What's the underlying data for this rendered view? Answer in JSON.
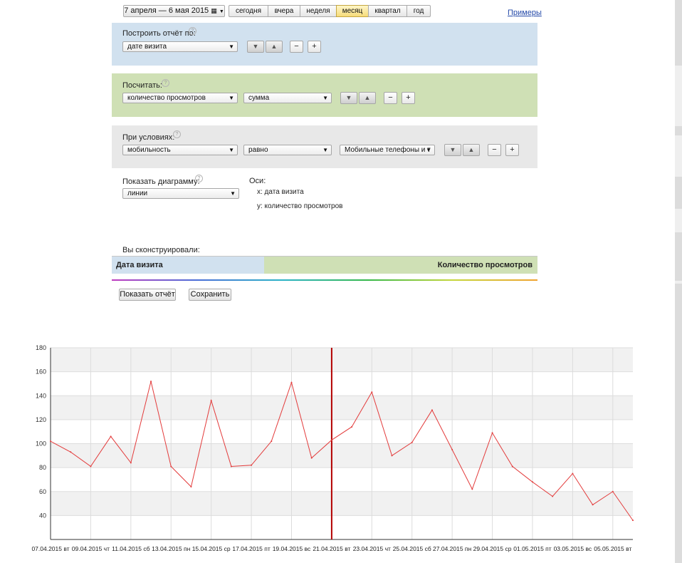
{
  "date_range": {
    "label": "7 апреля — 6 мая 2015"
  },
  "periods": [
    "сегодня",
    "вчера",
    "неделя",
    "месяц",
    "квартал",
    "год"
  ],
  "active_period": "месяц",
  "examples_link": "Примеры",
  "build": {
    "label": "Построить отчёт по:",
    "select": "дате визита",
    "help": "?",
    "minus": "−",
    "plus": "+"
  },
  "count": {
    "label": "Посчитать:",
    "select1": "количество просмотров",
    "select2": "сумма",
    "help": "?",
    "minus": "−",
    "plus": "+"
  },
  "conditions": {
    "label": "При условиях:",
    "select1": "мобильность",
    "select2": "равно",
    "select3": "Мобильные телефоны и т",
    "help": "?",
    "minus": "−",
    "plus": "+"
  },
  "diagram": {
    "label": "Показать диаграмму:",
    "select": "линии",
    "help": "?"
  },
  "axes": {
    "label": "Оси:",
    "x": "x:  дата визита",
    "y": "y:  количество просмотров"
  },
  "constructed": {
    "label": "Вы сконструировали:",
    "left": "Дата визита",
    "right": "Количество просмотров"
  },
  "actions": {
    "show": "Показать отчёт",
    "save": "Сохранить"
  },
  "colors": {
    "build_panel": "#d1e1ef",
    "count_panel": "#cfe0b5",
    "cond_panel": "#e8e8e8",
    "line": "#e33b3b",
    "marker": "#b30000",
    "active_period": "#f6dc7a"
  },
  "icons": {
    "calendar": "calendar-icon",
    "dropdown": "chevron-down-icon",
    "move_down": "arrow-down-icon",
    "move_up": "arrow-up-icon",
    "help": "help-icon"
  },
  "chart_data": {
    "type": "line",
    "title": "",
    "xlabel": "",
    "ylabel": "",
    "ylim": [
      20,
      180
    ],
    "yticks": [
      40,
      60,
      80,
      100,
      120,
      140,
      160,
      180
    ],
    "grid": true,
    "marker_index": 14,
    "x": [
      "07.04.2015 вт",
      "08.04.2015 ср",
      "09.04.2015 чт",
      "10.04.2015 пт",
      "11.04.2015 сб",
      "12.04.2015 вс",
      "13.04.2015 пн",
      "14.04.2015 вт",
      "15.04.2015 ср",
      "16.04.2015 чт",
      "17.04.2015 пт",
      "18.04.2015 сб",
      "19.04.2015 вс",
      "20.04.2015 пн",
      "21.04.2015 вт",
      "22.04.2015 ср",
      "23.04.2015 чт",
      "24.04.2015 пт",
      "25.04.2015 сб",
      "26.04.2015 вс",
      "27.04.2015 пн",
      "28.04.2015 вт",
      "29.04.2015 ср",
      "30.04.2015 чт",
      "01.05.2015 пт",
      "02.05.2015 сб",
      "03.05.2015 вс",
      "04.05.2015 пн",
      "05.05.2015 вт",
      "06.05.2015 ср"
    ],
    "tick_labels": [
      "07.04.2015 вт",
      "09.04.2015 чт",
      "11.04.2015 сб",
      "13.04.2015 пн",
      "15.04.2015 ср",
      "17.04.2015 пт",
      "19.04.2015 вс",
      "21.04.2015 вт",
      "23.04.2015 чт",
      "25.04.2015 сб",
      "27.04.2015 пн",
      "29.04.2015 ср",
      "01.05.2015 пт",
      "03.05.2015 вс",
      "05.05.2015 вт"
    ],
    "series": [
      {
        "values": [
          102,
          93,
          81,
          106,
          84,
          152,
          81,
          64,
          136,
          81,
          82,
          102,
          151,
          88,
          103,
          114,
          143,
          90,
          101,
          128,
          95,
          62,
          109,
          81,
          68,
          56,
          75,
          49,
          60,
          36
        ]
      }
    ]
  }
}
